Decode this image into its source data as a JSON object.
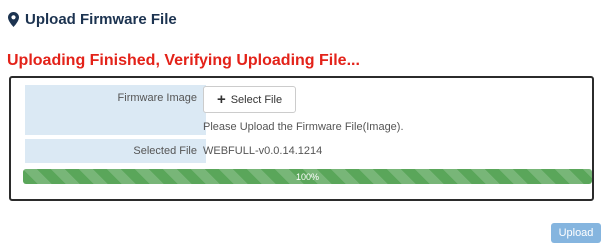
{
  "header": {
    "icon": "map-marker-icon",
    "title": "Upload Firmware File"
  },
  "status": {
    "message": "Uploading Finished, Verifying Uploading File...",
    "color": "#e32219"
  },
  "form": {
    "firmware_image_label": "Firmware Image",
    "select_file_icon": "plus-icon",
    "select_file_label": "Select File",
    "hint": "Please Upload the Firmware File(Image).",
    "selected_file_label": "Selected File",
    "selected_file_value": "WEBFULL-v0.0.14.1214"
  },
  "progress": {
    "value": 1.0,
    "label": "100%",
    "color": "#5aa65a"
  },
  "actions": {
    "upload_label": "Upload",
    "upload_color": "#85b5df"
  }
}
